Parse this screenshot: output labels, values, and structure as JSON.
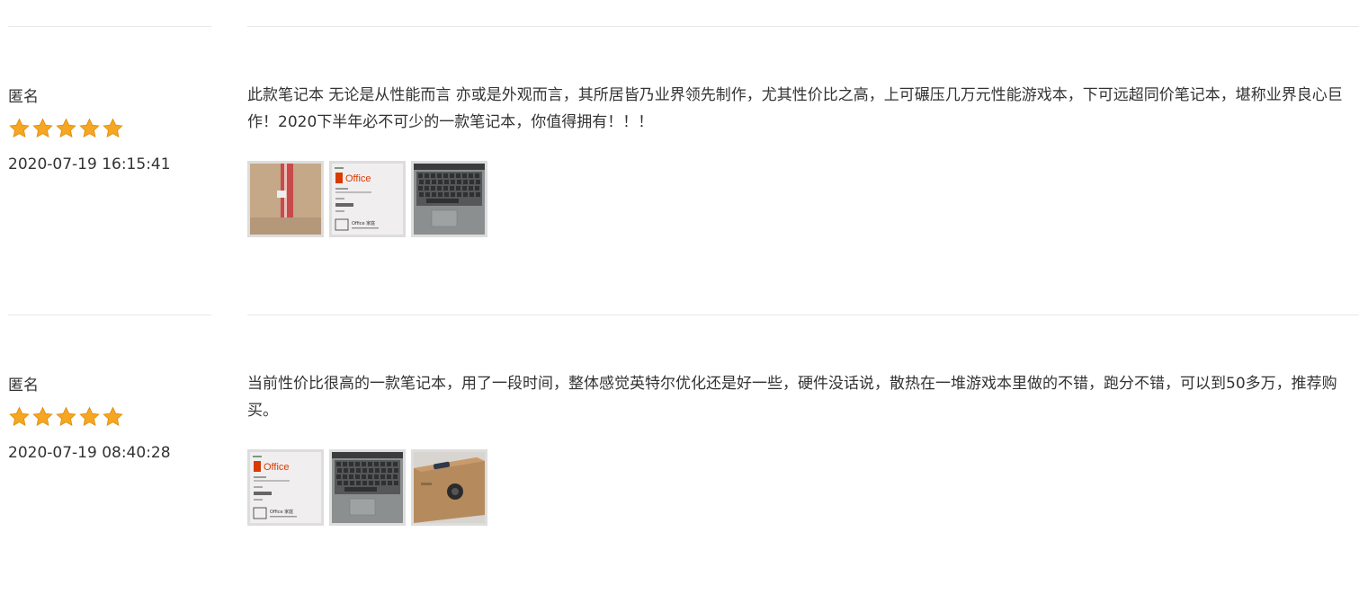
{
  "reviews": [
    {
      "author": "匿名",
      "rating": 5,
      "date": "2020-07-19 16:15:41",
      "content": "此款笔记本 无论是从性能而言 亦或是外观而言，其所居皆乃业界领先制作，尤其性价比之高，上可碾压几万元性能游戏本，下可远超同价笔记本，堪称业界良心巨作！2020下半年必不可少的一款笔记本，你值得拥有！！！",
      "images": [
        {
          "kind": "box-tape-photo"
        },
        {
          "kind": "office-card-photo",
          "brand": "Office",
          "small_text": "Office 家庭"
        },
        {
          "kind": "laptop-keyboard-photo"
        }
      ]
    },
    {
      "author": "匿名",
      "rating": 5,
      "date": "2020-07-19 08:40:28",
      "content": "当前性价比很高的一款笔记本，用了一段时间，整体感觉英特尔优化还是好一些，硬件没话说，散热在一堆游戏本里做的不错，跑分不错，可以到50多万，推荐购买。",
      "images": [
        {
          "kind": "office-card-photo",
          "brand": "Office",
          "small_text": "Office 家庭"
        },
        {
          "kind": "laptop-keyboard-photo"
        },
        {
          "kind": "laptop-box-photo"
        }
      ]
    }
  ],
  "colors": {
    "star": "#f5a623",
    "divider": "#e8e8e8",
    "thumb_border": "#dddddd",
    "office_red": "#d83b01"
  }
}
